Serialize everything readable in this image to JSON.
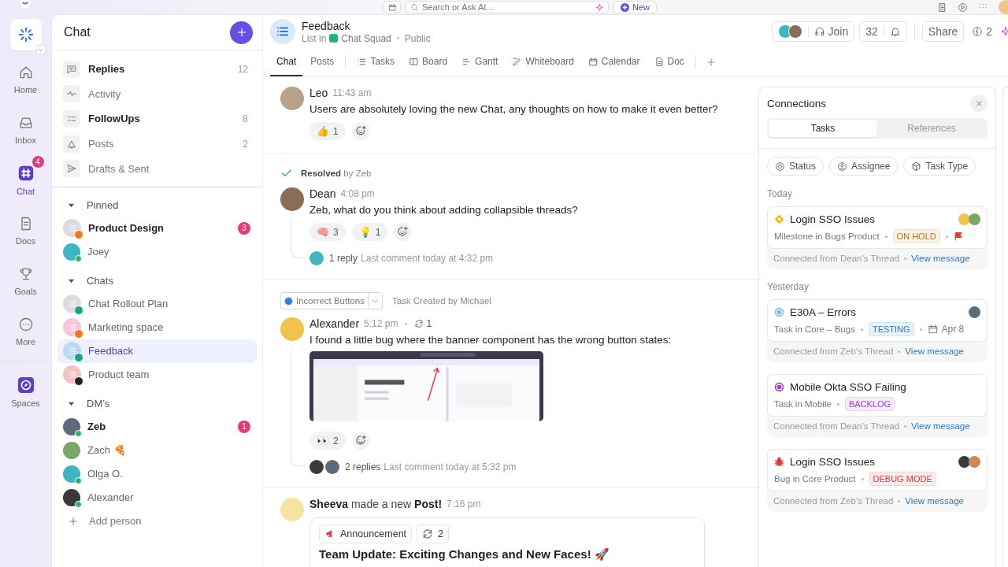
{
  "topbar": {
    "search": {
      "placeholder": "Search or Ask AI..."
    },
    "new_button": "New"
  },
  "rail": {
    "items": [
      {
        "label": "Home",
        "selected": false
      },
      {
        "label": "Inbox",
        "selected": false
      },
      {
        "label": "Chat",
        "selected": true,
        "badge": "4"
      },
      {
        "label": "Docs",
        "selected": false
      },
      {
        "label": "Goals",
        "selected": false
      },
      {
        "label": "More",
        "selected": false
      }
    ],
    "spaces": "Spaces"
  },
  "sidebar": {
    "title": "Chat",
    "nav": [
      {
        "label": "Replies",
        "unread": true,
        "count": "12"
      },
      {
        "label": "Activity",
        "unread": false
      },
      {
        "label": "FollowUps",
        "unread": true,
        "count": "8"
      },
      {
        "label": "Posts",
        "unread": false,
        "count": "2"
      },
      {
        "label": "Drafts & Sent",
        "unread": false
      }
    ],
    "sections": [
      {
        "title": "Pinned",
        "expanded": true,
        "items": [
          {
            "kind": "channel",
            "name": "Product Design",
            "color": "#dcdce0",
            "corner": {
              "color": "#f07a1a"
            },
            "unread": true,
            "badge": "3",
            "selected": false
          },
          {
            "kind": "person",
            "name": "Joey",
            "online": true,
            "unread": false,
            "selected": false
          }
        ]
      },
      {
        "title": "Chats",
        "expanded": true,
        "items": [
          {
            "kind": "channel",
            "name": "Chat Rollout Plan",
            "color": "#dcdce0",
            "corner": {
              "color": "#16a37f"
            },
            "unread": false,
            "selected": false
          },
          {
            "kind": "channel",
            "name": "Marketing space",
            "color": "#f5c6da",
            "corner": {
              "color": "#f07a1a"
            },
            "unread": false,
            "selected": false
          },
          {
            "kind": "channel",
            "name": "Feedback",
            "color": "#bcd9f3",
            "corner": {
              "color": "#16a37f"
            },
            "unread": false,
            "selected": true
          },
          {
            "kind": "channel",
            "name": "Product team",
            "color": "#f3c3c3",
            "corner": {
              "color": "#222222"
            },
            "unread": false,
            "selected": false
          }
        ]
      },
      {
        "title": "DM’s",
        "expanded": true,
        "items": [
          {
            "kind": "person",
            "name": "Zeb",
            "online": true,
            "unread": true,
            "badge": "1",
            "selected": false
          },
          {
            "kind": "person",
            "name": "Zach 🍕",
            "online": false,
            "unread": false,
            "selected": false
          },
          {
            "kind": "person",
            "name": "Olga O.",
            "online": true,
            "unread": false,
            "selected": false
          },
          {
            "kind": "person",
            "name": "Alexander",
            "online": true,
            "unread": false,
            "selected": false
          }
        ]
      }
    ],
    "add_person": "Add person"
  },
  "header": {
    "title": "Feedback",
    "location": "List in",
    "space": "Chat Squad",
    "visibility": "Public",
    "tabs": [
      {
        "label": "Chat",
        "kind": "plain",
        "selected": true
      },
      {
        "label": "Posts",
        "kind": "plain",
        "selected": false
      },
      {
        "label": "Tasks",
        "kind": "view",
        "selected": false
      },
      {
        "label": "Board",
        "kind": "view",
        "selected": false
      },
      {
        "label": "Gantt",
        "kind": "view",
        "selected": false
      },
      {
        "label": "Whiteboard",
        "kind": "view",
        "selected": false
      },
      {
        "label": "Calendar",
        "kind": "view",
        "selected": false
      },
      {
        "label": "Doc",
        "kind": "view",
        "selected": false
      }
    ],
    "join": "Join",
    "watchers": "32",
    "share": "Share",
    "automations": "2"
  },
  "messages": [
    {
      "kind": "message",
      "author": "Leo",
      "time": "11:43 am",
      "text": "Users are absolutely loving the new Chat, any thoughts on how to make it even better?",
      "reactions": [
        {
          "emoji": "👍",
          "count": "1"
        }
      ]
    },
    {
      "kind": "message",
      "banner": {
        "kind": "resolved",
        "text": "**Resolved** by Zeb"
      },
      "author": "Dean",
      "time": "4:08 pm",
      "text": "Zeb, what do you think about adding collapsible threads?",
      "reactions": [
        {
          "emoji": "🧠",
          "count": "3"
        },
        {
          "emoji": "💡",
          "count": "1"
        }
      ],
      "thread": {
        "replies": "1 reply",
        "last": "Last comment today at 4:32 pm"
      }
    },
    {
      "kind": "message",
      "banner": {
        "kind": "task",
        "task": "Incorrect Buttons",
        "text": "Task Created by Michael"
      },
      "author": "Alexander",
      "time": "5:12 pm",
      "sync": "1",
      "text": "I found a little bug where the banner component has the wrong button states:",
      "attachment": {
        "kind": "picture"
      },
      "reactions": [
        {
          "emoji": "👀",
          "count": "2"
        }
      ],
      "thread": {
        "replies": "2 replies",
        "last": "Last comment today at 5:32 pm"
      }
    },
    {
      "kind": "post",
      "header": "**Sheeva** made a new **Post!**",
      "time": "7:16 pm",
      "tag": "Announcement",
      "sync": "2",
      "title": "Team Update: Exciting Changes and New Faces! 🚀"
    }
  ],
  "connections": {
    "title": "Connections",
    "tabs": [
      {
        "label": "Tasks",
        "selected": true
      },
      {
        "label": "References",
        "selected": false
      }
    ],
    "filters": [
      "Status",
      "Assignee",
      "Task Type"
    ],
    "groups": [
      {
        "day": "Today",
        "cards": [
          {
            "kind": "milestone",
            "color": "#f5b400",
            "title": "Login SSO Issues",
            "meta": "Milestone in Bugs Product",
            "status": {
              "text": "ON HOLD",
              "color": "#b7701c"
            },
            "flag": true,
            "from": "Connected from Dean’s Thread",
            "link": "View message"
          }
        ]
      },
      {
        "day": "Yesterday",
        "cards": [
          {
            "kind": "task",
            "color": "#7fb8e0",
            "title": "E30A – Errors",
            "meta": "Task in Core – Bugs",
            "status": {
              "text": "TESTING",
              "color": "#2c79ad"
            },
            "flag": false,
            "date": "Apr 8",
            "from": "Connected from Zeb’s Thread",
            "link": "View message"
          },
          {
            "kind": "task",
            "color": "#a43fd0",
            "title": "Mobile Okta SSO Failing",
            "meta": "Task in Mobile",
            "status": {
              "text": "BACKLOG",
              "color": "#a03cc9"
            },
            "flag": false,
            "from": "Connected from Dean’s Thread",
            "link": "View message"
          },
          {
            "kind": "bug",
            "color": "#e03b3b",
            "title": "Login SSO Issues",
            "meta": "Bug in Core Product",
            "status": {
              "text": "DEBUG MODE",
              "color": "#d63a3a"
            },
            "flag": false,
            "from": "Connected from Zeb’s Thread",
            "link": "View message"
          }
        ]
      }
    ]
  }
}
